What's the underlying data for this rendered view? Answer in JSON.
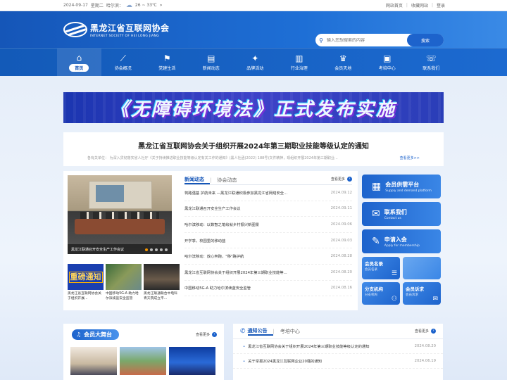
{
  "topbar": {
    "date": "2024-09-17",
    "weekday": "星期二",
    "city": "哈尔滨：",
    "temp": "26 ~ 33℃",
    "arrow": "»",
    "links": [
      "网站首页",
      "收藏网站",
      "登录"
    ]
  },
  "header": {
    "logo_cn": "黑龙江省互联网协会",
    "logo_en": "INTERNET SOCIETY OF HEI LONG JIANG",
    "search_placeholder": "输入您想搜索的内容",
    "search_button": "搜索"
  },
  "nav": [
    {
      "label": "首页",
      "icon": "⌂"
    },
    {
      "label": "协会概况",
      "icon": "⟋"
    },
    {
      "label": "党建生活",
      "icon": "⚑"
    },
    {
      "label": "新闻动态",
      "icon": "▤"
    },
    {
      "label": "品牌活动",
      "icon": "✦"
    },
    {
      "label": "行业治理",
      "icon": "▥"
    },
    {
      "label": "会员天地",
      "icon": "♛"
    },
    {
      "label": "考培中心",
      "icon": "▣"
    },
    {
      "label": "联系我们",
      "icon": "☏"
    }
  ],
  "banner": {
    "title": "《无障碍环境法》正式发布实施"
  },
  "headline": {
    "title": "黑龙江省互联网协会关于组织开展2024年第三期职业技能等级认定的通知",
    "summary": "各有关单位： 为深入贯彻落实省人社厅《关于持续推进职业技能等级认定有关工作的通知》(黑人社函(2022) 188号)文件精神，现组织开展2024年第三期职业...",
    "more": "查看更多>>"
  },
  "news": {
    "main_caption": "黑龙江联通召开安全生产工作会议",
    "thumbs": [
      {
        "label": "重磅通知",
        "text": "黑龙江省互联网协会关于组织开展..."
      },
      {
        "label": "",
        "text": "中国移动5G-A 助力哈尔滨续蓝安全监管"
      },
      {
        "label": "",
        "text": "黑龙江联通联合中电科青天院成立平..."
      }
    ],
    "tabs": [
      "新闻动态",
      "协会动态"
    ],
    "more": "查看更多",
    "items": [
      {
        "title": "筑路强基 护航未来 —黑龙江联通积极参加黑龙江省网络安全...",
        "date": "2024.09.12"
      },
      {
        "title": "黑龙江联通召开安全生产工作会议",
        "date": "2024.09.11"
      },
      {
        "title": "哈尔滨移动：以数智之笔绘就乡村振兴新图景",
        "date": "2024.09.06"
      },
      {
        "title": "开学季，校园里的移动蓝",
        "date": "2024.09.03"
      },
      {
        "title": "哈尔滨移动：放心奔跑，\"移\"路护航",
        "date": "2024.08.28"
      },
      {
        "title": "黑龙江省互联网协会关于组织开展2024年第三期职业技能等...",
        "date": "2024.08.20"
      },
      {
        "title": "中国移动5G-A 助力哈尔滨续蓝安全监管",
        "date": "2024.08.16"
      }
    ]
  },
  "side": {
    "buttons": [
      {
        "title": "会员供需平台",
        "sub": "Supply and demand platform",
        "icon": "▦"
      },
      {
        "title": "联系我们",
        "sub": "Contact us",
        "icon": "✉"
      },
      {
        "title": "申请入会",
        "sub": "Apply for membership",
        "icon": "✎"
      }
    ],
    "tiles": [
      {
        "title": "会员名录",
        "sub": "会员名录",
        "icon": "☰"
      },
      {
        "title": "",
        "sub": "",
        "icon": ""
      },
      {
        "title": "分支机构",
        "sub": "分支机构",
        "icon": "⚇"
      },
      {
        "title": "会员诉求",
        "sub": "会员诉求",
        "icon": "✉"
      }
    ]
  },
  "stage": {
    "title": "会员大舞台",
    "more": "查看更多"
  },
  "notice": {
    "tabs": [
      "通知公告",
      "考培中心"
    ],
    "more": "查看更多",
    "items": [
      {
        "title": "黑龙江省互联网协会关于组织开展2024年第三期职业技能等级认定的通知",
        "date": "2024.08.20"
      },
      {
        "title": "关于举报2024黑龙江互联网企业20强的通知",
        "date": "2024.06.19"
      }
    ]
  },
  "colors": {
    "primary": "#1556b8",
    "accent": "#1d63cc",
    "highlight": "#f29400"
  }
}
